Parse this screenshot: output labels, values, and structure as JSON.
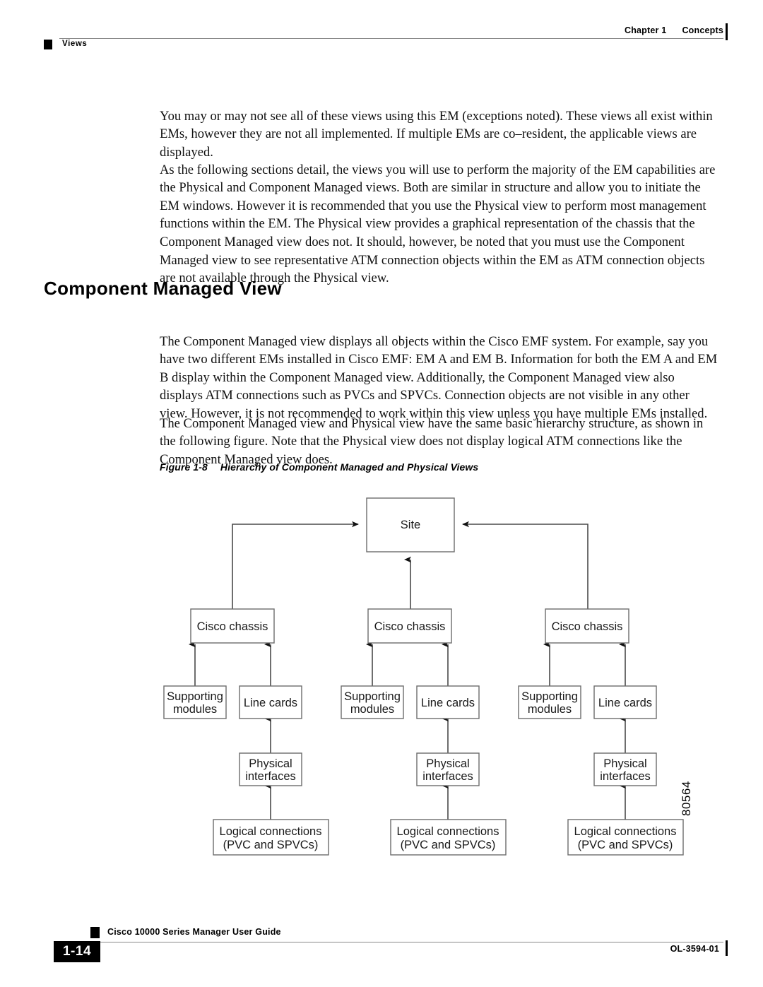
{
  "header": {
    "chapter": "Chapter 1",
    "chapter_topic": "Concepts",
    "running_head": "Views"
  },
  "body": {
    "paragraph_1": "You may or may not see all of these views using this EM (exceptions noted). These views all exist within EMs, however they are not all implemented. If multiple EMs are co–resident, the applicable views are displayed.",
    "paragraph_2": "As the following sections detail, the views you will use to perform the majority of the EM capabilities are the Physical and Component Managed views. Both are similar in structure and allow you to initiate the EM windows. However it is recommended that you use the Physical view to perform most management functions within the EM. The Physical view provides a graphical representation of the chassis that the Component Managed view does not. It should, however, be noted that you must use the Component Managed view to see representative ATM connection objects within the EM as ATM connection objects are not available through the Physical view.",
    "section_title": "Component Managed View",
    "paragraph_3": "The Component Managed view displays all objects within the Cisco EMF system. For example, say you have two different EMs installed in Cisco EMF: EM A and EM B. Information for both the EM A and EM B display within the Component Managed view. Additionally, the Component Managed view also displays ATM connections such as PVCs and SPVCs. Connection objects are not visible in any other view. However, it is not recommended to work within this view unless you have multiple EMs installed.",
    "paragraph_4": "The Component Managed view and Physical view have the same basic hierarchy structure, as shown in the following figure. Note that the Physical view does not display logical ATM connections like the Component Managed view does."
  },
  "figure": {
    "caption_number": "Figure 1-8",
    "caption_title": "Hierarchy of Component Managed and Physical Views",
    "art_number": "80564",
    "nodes": {
      "site": "Site",
      "chassis": "Cisco chassis",
      "supporting_modules_line1": "Supporting",
      "supporting_modules_line2": "modules",
      "line_cards": "Line cards",
      "physical_interfaces_line1": "Physical",
      "physical_interfaces_line2": "interfaces",
      "logical_connections_line1": "Logical connections",
      "logical_connections_line2": "(PVC and SPVCs)"
    },
    "columns": [
      {
        "id": "column-left",
        "chassis": "Cisco chassis",
        "supporting_modules": "Supporting modules",
        "line_cards": "Line cards",
        "physical_interfaces": "Physical interfaces",
        "logical_connections": "Logical connections (PVC and SPVCs)"
      },
      {
        "id": "column-center",
        "chassis": "Cisco chassis",
        "supporting_modules": "Supporting modules",
        "line_cards": "Line cards",
        "physical_interfaces": "Physical interfaces",
        "logical_connections": "Logical connections (PVC and SPVCs)"
      },
      {
        "id": "column-right",
        "chassis": "Cisco chassis",
        "supporting_modules": "Supporting modules",
        "line_cards": "Line cards",
        "physical_interfaces": "Physical interfaces",
        "logical_connections": "Logical connections (PVC and SPVCs)"
      }
    ]
  },
  "footer": {
    "guide_title": "Cisco 10000 Series Manager User Guide",
    "page_number": "1-14",
    "doc_id": "OL-3594-01"
  },
  "colors": {
    "text": "#000000",
    "rule": "#8a8a8a",
    "box_stroke": "#6d6d6d",
    "edge": "#4a4a4a",
    "page_bg": "#ffffff"
  }
}
